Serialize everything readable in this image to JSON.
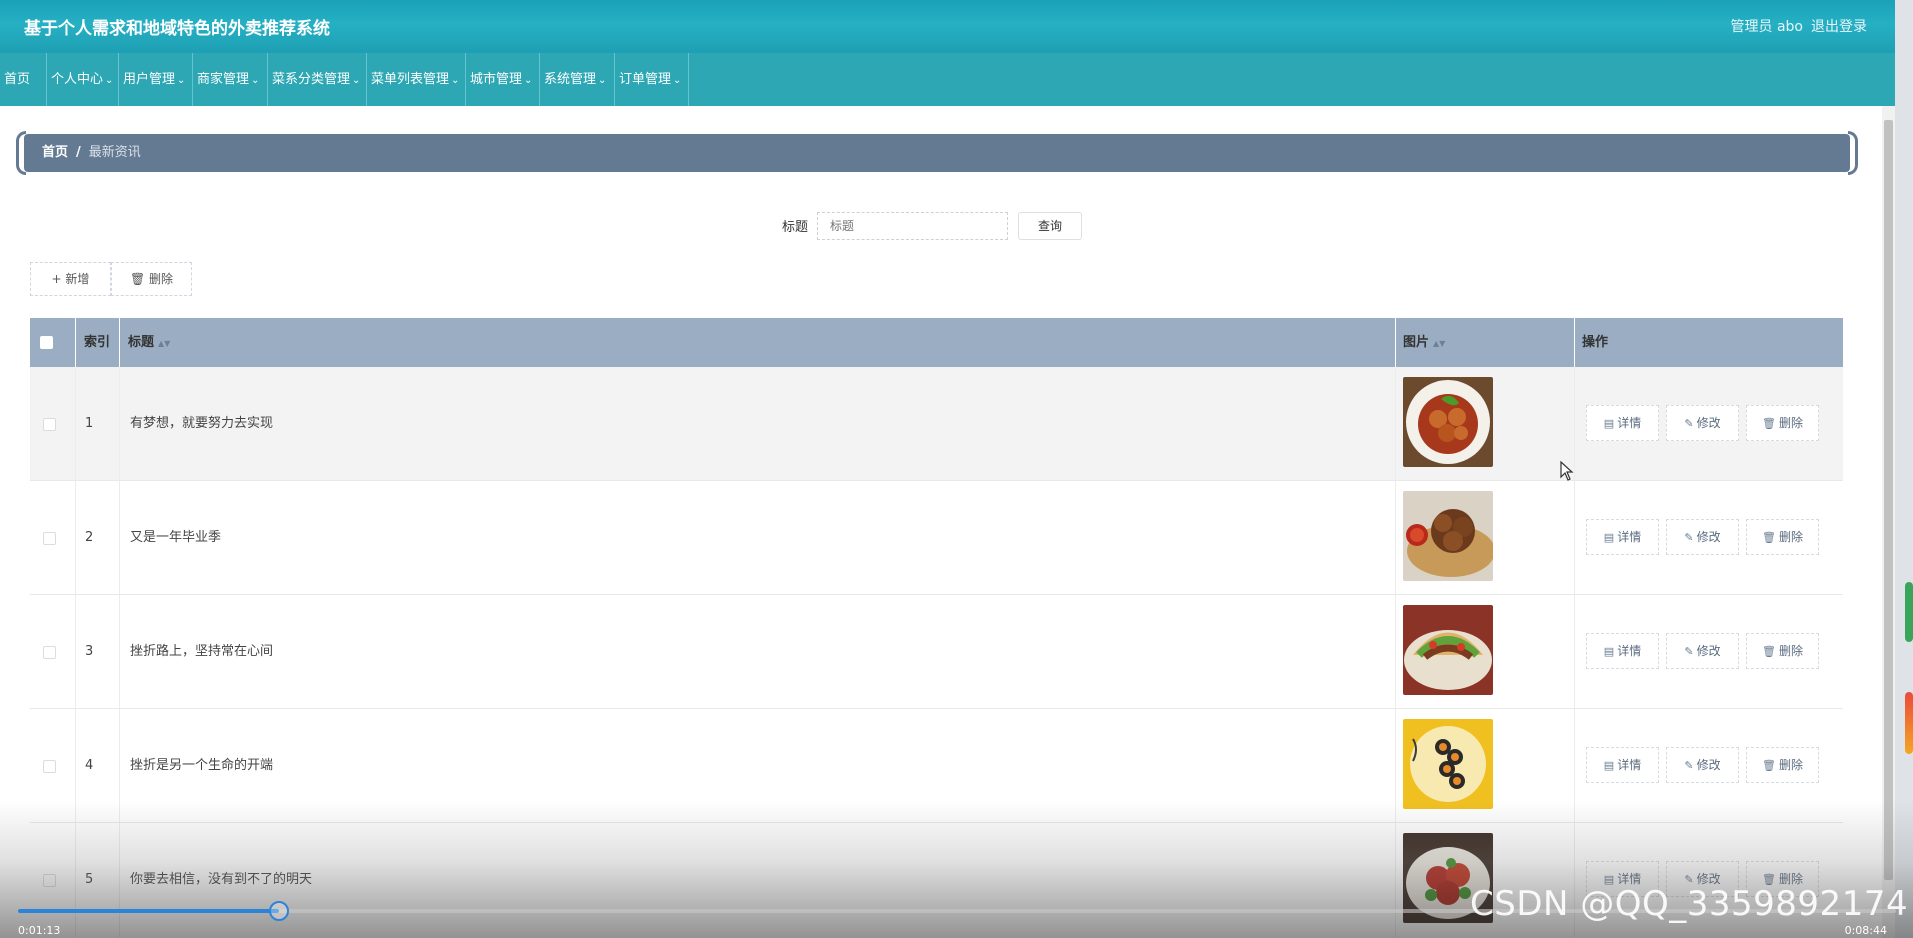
{
  "header": {
    "title": "基于个人需求和地域特色的外卖推荐系统",
    "user": "管理员 abo",
    "logout": "退出登录"
  },
  "nav": [
    {
      "label": "首页",
      "dropdown": false
    },
    {
      "label": "个人中心",
      "dropdown": true
    },
    {
      "label": "用户管理",
      "dropdown": true
    },
    {
      "label": "商家管理",
      "dropdown": true
    },
    {
      "label": "菜系分类管理",
      "dropdown": true
    },
    {
      "label": "菜单列表管理",
      "dropdown": true
    },
    {
      "label": "城市管理",
      "dropdown": true
    },
    {
      "label": "系统管理",
      "dropdown": true
    },
    {
      "label": "订单管理",
      "dropdown": true
    }
  ],
  "breadcrumb": {
    "home": "首页",
    "separator": "/",
    "current": "最新资讯"
  },
  "search": {
    "label": "标题",
    "placeholder": "标题",
    "button": "查询"
  },
  "toolbar": {
    "add": "新增",
    "delete": "删除"
  },
  "table": {
    "headers": {
      "index": "索引",
      "title": "标题",
      "image": "图片",
      "actions": "操作"
    },
    "rows": [
      {
        "index": "1",
        "title": "有梦想，就要努力去实现",
        "image": "food-photo-1"
      },
      {
        "index": "2",
        "title": "又是一年毕业季",
        "image": "food-photo-2"
      },
      {
        "index": "3",
        "title": "挫折路上，坚持常在心间",
        "image": "food-photo-3"
      },
      {
        "index": "4",
        "title": "挫折是另一个生命的开端",
        "image": "food-photo-4"
      },
      {
        "index": "5",
        "title": "你要去相信，没有到不了的明天",
        "image": "food-photo-5"
      }
    ],
    "row_actions": {
      "detail": "详情",
      "edit": "修改",
      "delete": "删除"
    }
  },
  "video": {
    "elapsed": "0:01:13",
    "total": "0:08:44",
    "progress_fraction": 0.139
  },
  "watermark": "CSDN @QQ_3359892174",
  "colors": {
    "header": "#1aa1b8",
    "nav": "#2ea7b4",
    "breadcrumb": "#647a92",
    "table_header": "#9aadc3",
    "progress": "#2c84d8"
  }
}
